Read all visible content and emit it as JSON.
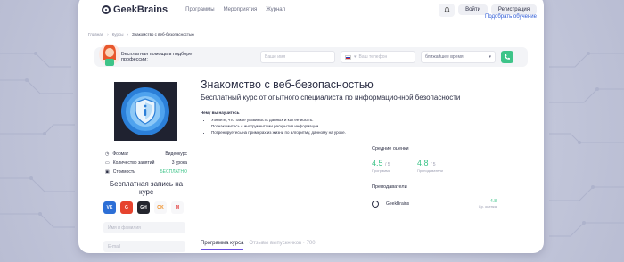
{
  "nav": {
    "logo": "GeekBrains",
    "links": [
      "Программы",
      "Мероприятия",
      "Журнал"
    ],
    "login": "Войти",
    "register": "Регистрация",
    "pick_training": "Подобрать обучение"
  },
  "breadcrumb": [
    "Главная",
    "Курсы",
    "Знакомство с веб-безопасностью"
  ],
  "helpbar": {
    "text": "Бесплатная помощь в подборе профессии:",
    "name_placeholder": "Ваше имя",
    "phone_placeholder": "Ваш телефон",
    "time_value": "ближайшее время"
  },
  "course": {
    "title": "Знакомство с веб-безопасностью",
    "subtitle": "Бесплатный курс от опытного специалиста по информационной безопасности",
    "learn_heading": "Чему вы научитесь",
    "learn_items": [
      "Узнаете, что такое уязвимость данных и как её искать.",
      "Познакомитесь с инструментами раскрытия информации.",
      "Потренируетесь на примерах из жизни по алгоритму, данному на уроке."
    ]
  },
  "info": {
    "format_label": "Формат",
    "format_value": "Видеокурс",
    "lessons_label": "Количество занятий",
    "lessons_value": "3 урока",
    "price_label": "Стоимость",
    "price_value": "БЕСПЛАТНО"
  },
  "enroll": {
    "title": "Бесплатная запись на курс",
    "name_placeholder": "Имя и фамилия",
    "email_placeholder": "E-mail",
    "socials": [
      "VK",
      "G",
      "GH",
      "OK",
      "M"
    ]
  },
  "ratings": {
    "heading": "Средние оценки",
    "program_value": "4.5",
    "program_max": "/ 5",
    "program_label": "Программа",
    "teachers_value": "4.8",
    "teachers_max": "/ 5",
    "teachers_label": "Преподаватели"
  },
  "teachers": {
    "heading": "Преподаватели",
    "name": "GeekBrains",
    "score": "4.8",
    "score_label": "Ср. оценка"
  },
  "tabs": [
    "Программа курса",
    "Отзывы выпускников · 700"
  ]
}
